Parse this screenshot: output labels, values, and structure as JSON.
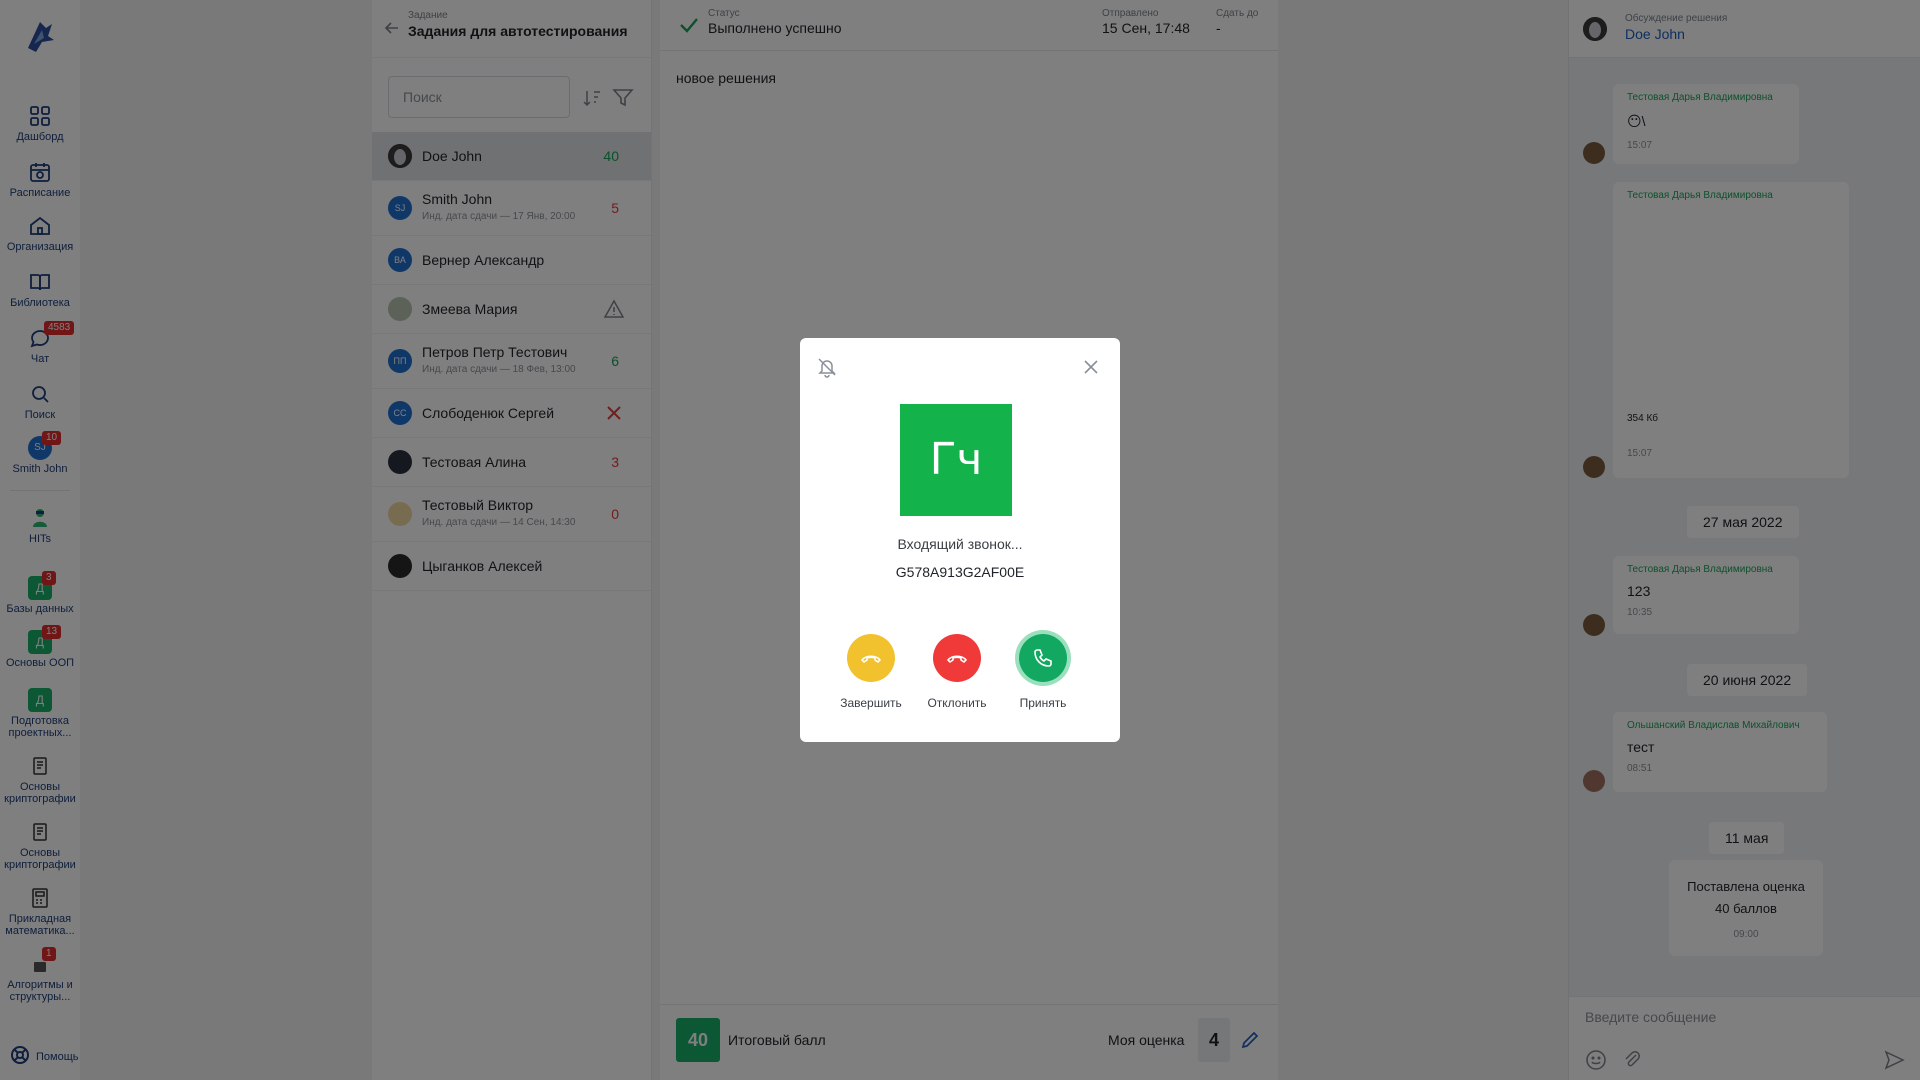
{
  "nav": {
    "items": [
      {
        "label": "Дашборд"
      },
      {
        "label": "Расписание"
      },
      {
        "label": "Организация"
      },
      {
        "label": "Библиотека"
      },
      {
        "label": "Чат",
        "badge": "4583"
      },
      {
        "label": "Поиск"
      },
      {
        "label": "Smith John",
        "avatar": "SJ",
        "badge": "10"
      },
      {
        "label": "HITs"
      },
      {
        "label": "Базы данных",
        "icon_text": "Д",
        "badge": "3"
      },
      {
        "label": "Основы ООП",
        "icon_text": "Д",
        "badge": "13"
      },
      {
        "label": "Подготовка проектных...",
        "icon_text": "Д"
      },
      {
        "label": "Основы криптографии"
      },
      {
        "label": "Основы криптографии"
      },
      {
        "label": "Прикладная математика..."
      },
      {
        "label": "Алгоритмы и структуры...",
        "badge": "1"
      }
    ],
    "help": "Помощь"
  },
  "task": {
    "label": "Задание",
    "title": "Задания для автотестирования"
  },
  "search": {
    "placeholder": "Поиск"
  },
  "students": [
    {
      "name": "Doe John",
      "score": "40",
      "score_color": "#18a058",
      "selected": true
    },
    {
      "name": "Smith John",
      "initials": "SJ",
      "sub": "Инд. дата сдачи — 17 Янв, 20:00",
      "score": "5",
      "score_color": "#e03c3c"
    },
    {
      "name": "Вернер Александр",
      "initials": "ВА"
    },
    {
      "name": "Змеева Мария",
      "flag": "warning"
    },
    {
      "name": "Петров Петр Тестович",
      "initials": "ПП",
      "sub": "Инд. дата сдачи — 18 Фев, 13:00",
      "score": "6",
      "score_color": "#18a058"
    },
    {
      "name": "Слободенюк Сергей",
      "initials": "СС",
      "flag": "rejected"
    },
    {
      "name": "Тестовая Алина",
      "score": "3",
      "score_color": "#e03c3c"
    },
    {
      "name": "Тестовый Виктор",
      "sub": "Инд. дата сдачи — 14 Сен, 14:30",
      "score": "0",
      "score_color": "#e03c3c"
    },
    {
      "name": "Цыганков Алексей"
    }
  ],
  "solution": {
    "status_label": "Статус",
    "status_value": "Выполнено успешно",
    "sent_label": "Отправлено",
    "sent_value": "15 Сен, 17:48",
    "due_label": "Сдать до",
    "due_value": "-",
    "body": "новое решения",
    "final_score": "40",
    "final_label": "Итоговый балл",
    "my_label": "Моя оценка",
    "my_score": "4"
  },
  "chat": {
    "header_label": "Обсуждение решения",
    "header_name": "Doe John",
    "messages": [
      {
        "author": "Тестовая Дарья Владимировна",
        "text": "😶\\",
        "time": "15:07"
      },
      {
        "author": "Тестовая Дарья Владимировна",
        "text": "354 Кб",
        "time": "15:07"
      },
      {
        "author": "Тестовая Дарья Владимировна",
        "text": "123",
        "time": "10:35"
      },
      {
        "author": "Ольшанский Владислав Михайлович",
        "text": "тест",
        "time": "08:51"
      }
    ],
    "dates": [
      "27 мая 2022",
      "20 июня 2022",
      "11 мая"
    ],
    "system": {
      "line1": "Поставлена оценка",
      "line2": "40 баллов",
      "time": "09:00"
    },
    "input_placeholder": "Введите сообщение"
  },
  "call": {
    "initials": "Гч",
    "title": "Входящий звонок...",
    "caller_id": "G578A913G2AF00E",
    "end_label": "Завершить",
    "decline_label": "Отклонить",
    "accept_label": "Принять",
    "colors": {
      "avatar": "#13b24a",
      "end": "#f2c12e",
      "decline": "#f03a3a",
      "accept": "#12a861"
    }
  }
}
